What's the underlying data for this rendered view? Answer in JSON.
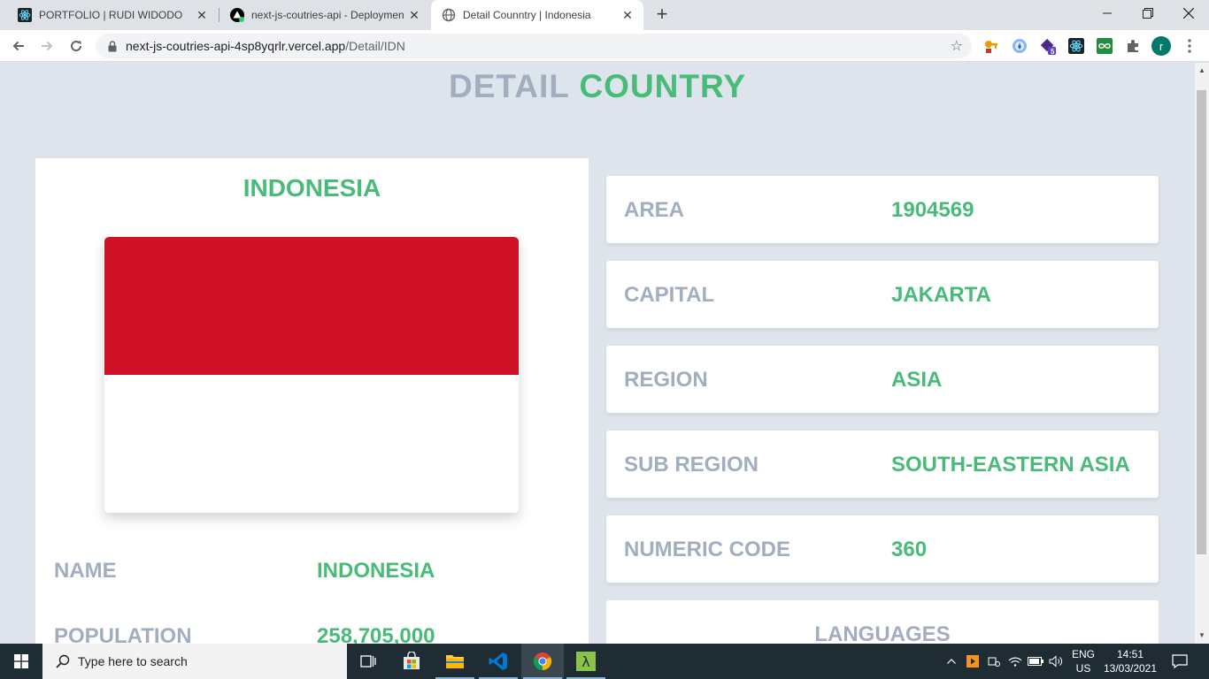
{
  "browser": {
    "tabs": [
      {
        "title": "PORTFOLIO | RUDI WIDODO",
        "icon": "react-icon"
      },
      {
        "title": "next-js-coutries-api - Deploymen",
        "icon": "vercel-icon"
      },
      {
        "title": "Detail Counntry | Indonesia",
        "icon": "globe-icon"
      }
    ],
    "url_host": "next-js-coutries-api-4sp8yqrlr.vercel.app",
    "url_path": "/Detail/IDN",
    "profile_initial": "r",
    "extension_badge": "5"
  },
  "page": {
    "heading_part1": "DETAIL",
    "heading_part2": "COUNTRY",
    "country_title": "INDONESIA",
    "flag_colors": {
      "top": "#ce1126",
      "bottom": "#ffffff"
    },
    "info_rows": [
      {
        "label": "NAME",
        "value": "INDONESIA"
      },
      {
        "label": "POPULATION",
        "value": "258,705,000"
      }
    ],
    "stats": [
      {
        "label": "AREA",
        "value": "1904569"
      },
      {
        "label": "CAPITAL",
        "value": "JAKARTA"
      },
      {
        "label": "REGION",
        "value": "ASIA"
      },
      {
        "label": "SUB REGION",
        "value": "SOUTH-EASTERN ASIA"
      },
      {
        "label": "NUMERIC CODE",
        "value": "360"
      }
    ],
    "languages_label": "LANGUAGES",
    "colors": {
      "accent": "#48bb78",
      "muted": "#a0aec0",
      "background": "#dee4ec"
    }
  },
  "taskbar": {
    "search_placeholder": "Type here to search",
    "language_line1": "ENG",
    "language_line2": "US",
    "time": "14:51",
    "date": "13/03/2021"
  }
}
